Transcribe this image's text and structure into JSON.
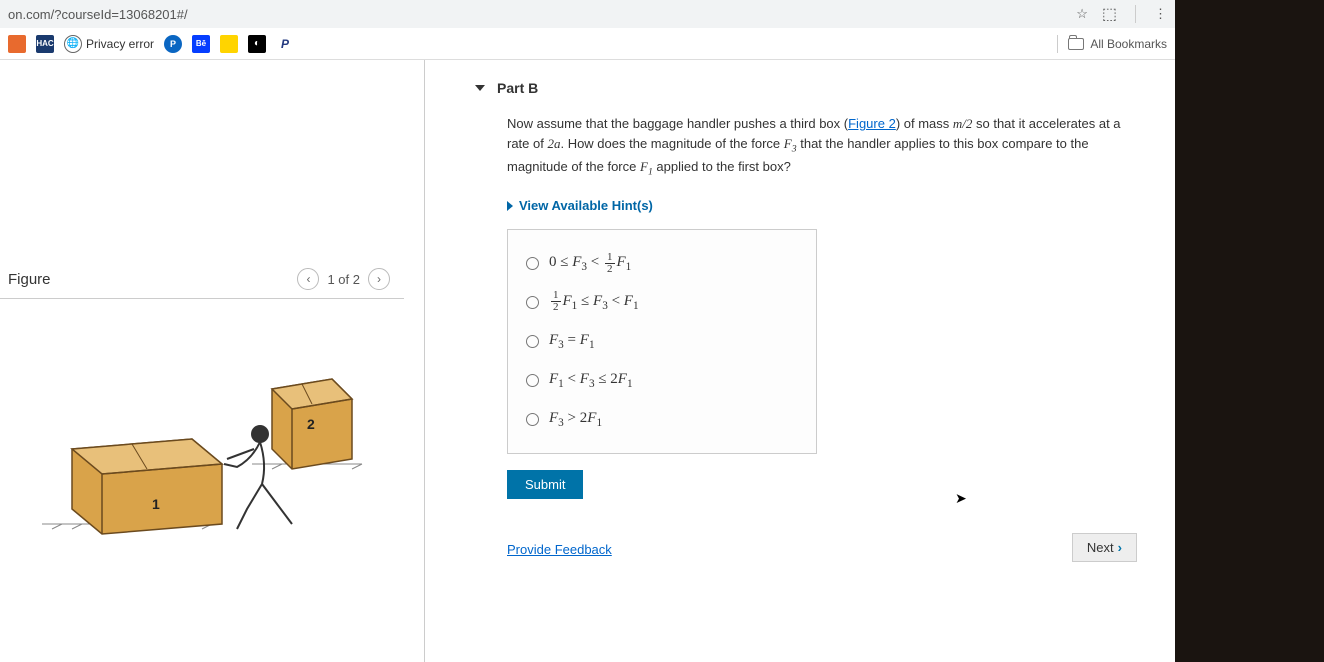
{
  "url": "on.com/?courseId=13068201#/",
  "bookmarks": {
    "privacy_error": "Privacy error",
    "all_bookmarks": "All Bookmarks"
  },
  "figure": {
    "label": "Figure",
    "nav_text": "1 of 2",
    "box1_label": "1",
    "box2_label": "2"
  },
  "part": {
    "title": "Part B",
    "question_pre": "Now assume that the baggage handler pushes a third box (",
    "figure_link": "Figure 2",
    "question_post1": ") of mass ",
    "mass_expr": "m/2",
    "question_post2": " so that it accelerates at a rate of ",
    "accel_expr": "2a",
    "question_post3": ". How does the magnitude of the force ",
    "f3": "F₃",
    "question_post4": " that the handler applies to this box compare to the magnitude of the force ",
    "f1": "F₁",
    "question_post5": " applied to the first box?",
    "hints_label": "View Available Hint(s)",
    "options": {
      "a_text": "0 ≤ F₃ < ½F₁",
      "b_text": "½F₁ ≤ F₃ < F₁",
      "c_text": "F₃ = F₁",
      "d_text": "F₁ < F₃ ≤ 2F₁",
      "e_text": "F₃ > 2F₁"
    },
    "submit_label": "Submit",
    "feedback_label": "Provide Feedback",
    "next_label": "Next"
  }
}
